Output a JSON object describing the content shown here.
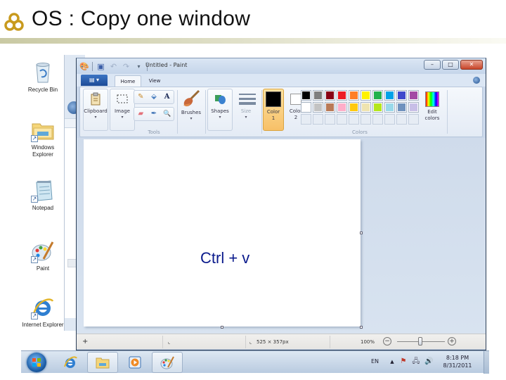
{
  "slide": {
    "title": "OS : Copy one window"
  },
  "desktop": {
    "icons": [
      {
        "label": "Recycle Bin",
        "name": "recycle-bin"
      },
      {
        "label": "Windows Explorer",
        "name": "windows-explorer"
      },
      {
        "label": "Notepad",
        "name": "notepad"
      },
      {
        "label": "Paint",
        "name": "paint"
      },
      {
        "label": "Internet Explorer",
        "name": "internet-explorer"
      }
    ]
  },
  "paint": {
    "window_title": "Untitled - Paint",
    "caption_buttons": {
      "minimize": "–",
      "maximize": "□",
      "close": "✕"
    },
    "tabs": {
      "home": "Home",
      "view": "View"
    },
    "app_menu_icon": "▤ ▾",
    "ribbon": {
      "clipboard": "Clipboard",
      "image": "Image",
      "tools_group": "Tools",
      "brushes": "Brushes",
      "shapes": "Shapes",
      "size": "Size",
      "color1": "Color",
      "color1_num": "1",
      "color2": "Color",
      "color2_num": "2",
      "edit_colors_1": "Edit",
      "edit_colors_2": "colors",
      "colors_group": "Colors",
      "dropdown_arrow": "▾"
    },
    "tools": {
      "row1": [
        "✎",
        "⬙",
        "A"
      ],
      "row2": [
        "▰",
        "✒",
        "🔍"
      ]
    },
    "color1_value": "#000000",
    "color2_value": "#ffffff",
    "palette": [
      "#000000",
      "#7f7f7f",
      "#880015",
      "#ed1c24",
      "#ff7f27",
      "#fff200",
      "#22b14c",
      "#00a2e8",
      "#3f48cc",
      "#a349a4",
      "#ffffff",
      "#c3c3c3",
      "#b97a57",
      "#ffaec9",
      "#ffc90e",
      "#efe4b0",
      "#b5e61d",
      "#99d9ea",
      "#7092be",
      "#c8bfe7"
    ],
    "canvas_text": "Ctrl + v",
    "status": {
      "cursor_icon": "+",
      "selection_icon": "⌞",
      "size_icon": "⌞",
      "canvas_size": "525 × 357px",
      "zoom_level": "100%",
      "zoom_minus": "−",
      "zoom_plus": "+"
    }
  },
  "taskbar": {
    "language": "EN",
    "tray_arrow": "▲",
    "time": "8:18 PM",
    "date": "8/31/2011",
    "apps": [
      {
        "name": "internet-explorer",
        "pinned": false
      },
      {
        "name": "windows-explorer",
        "pinned": true
      },
      {
        "name": "media-player",
        "pinned": false
      },
      {
        "name": "paint",
        "pinned": true
      }
    ]
  }
}
